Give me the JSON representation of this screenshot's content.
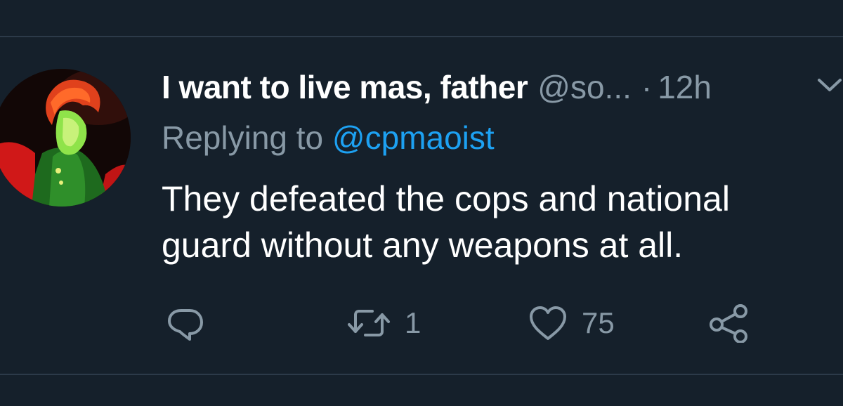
{
  "tweet": {
    "author": {
      "display_name": "I want to live mas, father",
      "handle": "@so...",
      "avatar": "avatar"
    },
    "separator": "·",
    "time": "12h",
    "replying_to": {
      "prefix": "Replying to",
      "mention": "@cpmaoist"
    },
    "text": "They defeated the cops and national guard without any weapons at all.",
    "actions": {
      "reply": {
        "icon": "reply-icon",
        "count": ""
      },
      "retweet": {
        "icon": "retweet-icon",
        "count": "1"
      },
      "like": {
        "icon": "heart-icon",
        "count": "75"
      },
      "share": {
        "icon": "share-icon"
      }
    },
    "menu_icon": "chevron-down-icon"
  },
  "colors": {
    "background": "#15202b",
    "primary_text": "#ffffff",
    "secondary_text": "#8899a6",
    "accent": "#1da1f2",
    "divider": "#2c3a49"
  }
}
